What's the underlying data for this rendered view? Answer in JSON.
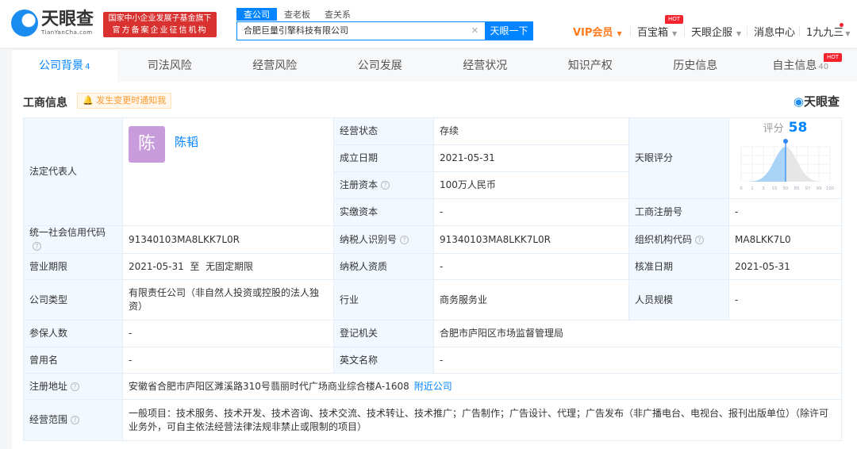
{
  "header": {
    "logo_cn": "天眼查",
    "logo_en": "TianYanCha.com",
    "badge_line1": "国家中小企业发展子基金旗下",
    "badge_line2": "官方备案企业征信机构",
    "search_tabs": [
      "查公司",
      "查老板",
      "查关系"
    ],
    "search_value": "合肥巨量引擎科技有限公司",
    "search_button": "天眼一下",
    "nav": {
      "vip": "VIP会员",
      "treasure": "百宝箱",
      "hot": "HOT",
      "enterprise": "天眼企服",
      "messages": "消息中心",
      "user": "1九九三"
    }
  },
  "tabs": [
    {
      "label": "公司背景",
      "count": "4"
    },
    {
      "label": "司法风险"
    },
    {
      "label": "经营风险"
    },
    {
      "label": "公司发展"
    },
    {
      "label": "经营状况"
    },
    {
      "label": "知识产权"
    },
    {
      "label": "历史信息"
    },
    {
      "label": "自主信息",
      "count": "40",
      "hot": "HOT"
    }
  ],
  "section": {
    "title": "工商信息",
    "notify": "发生变更时通知我",
    "brand": "天眼查"
  },
  "info": {
    "legal_rep_label": "法定代表人",
    "legal_rep_avatar": "陈",
    "legal_rep_name": "陈韬",
    "status_label": "经营状态",
    "status": "存续",
    "founded_label": "成立日期",
    "founded": "2021-05-31",
    "reg_capital_label": "注册资本",
    "reg_capital": "100万人民币",
    "paid_capital_label": "实缴资本",
    "paid_capital": "-",
    "score_label": "天眼评分",
    "score_title": "评分",
    "score": 58,
    "score_ticks": [
      "0",
      "1",
      "3",
      "15",
      "50",
      "85",
      "97",
      "99",
      "100"
    ],
    "biz_reg_label": "工商注册号",
    "biz_reg": "-",
    "credit_code_label": "统一社会信用代码",
    "credit_code": "91340103MA8LKK7L0R",
    "taxpayer_id_label": "纳税人识别号",
    "taxpayer_id": "91340103MA8LKK7L0R",
    "org_code_label": "组织机构代码",
    "org_code": "MA8LKK7L0",
    "term_label": "营业期限",
    "term": "2021-05-31  至  无固定期限",
    "taxpayer_qual_label": "纳税人资质",
    "taxpayer_qual": "-",
    "approval_label": "核准日期",
    "approval": "2021-05-31",
    "type_label": "公司类型",
    "type": "有限责任公司（非自然人投资或控股的法人独资）",
    "industry_label": "行业",
    "industry": "商务服务业",
    "staff_label": "人员规模",
    "staff": "-",
    "insured_label": "参保人数",
    "insured": "-",
    "authority_label": "登记机关",
    "authority": "合肥市庐阳区市场监督管理局",
    "former_label": "曾用名",
    "former": "-",
    "english_label": "英文名称",
    "english": "-",
    "address_label": "注册地址",
    "address": "安徽省合肥市庐阳区濉溪路310号翡丽时代广场商业综合楼A-1608",
    "nearby": "附近公司",
    "scope_label": "经营范围",
    "scope": "一般项目：技术服务、技术开发、技术咨询、技术交流、技术转让、技术推广；广告制作；广告设计、代理；广告发布（非广播电台、电视台、报刊出版单位）（除许可业务外，可自主依法经营法律法规非禁止或限制的项目）"
  }
}
